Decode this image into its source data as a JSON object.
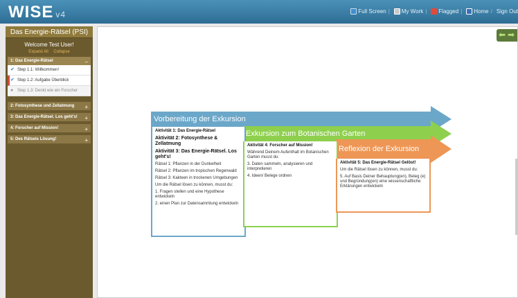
{
  "app": {
    "logo": "WISE",
    "version": "v4"
  },
  "toplinks": {
    "fullscreen": "Full Screen",
    "mywork": "My Work",
    "flagged": "Flagged",
    "home": "Home",
    "signout": "Sign Out",
    "separator": "/"
  },
  "sidebar": {
    "project_title": "Das Energie-Rätsel (PSI)",
    "welcome": "Welcome Test User!",
    "expand_all": "Expand All",
    "collapse": "Collapse",
    "activities": [
      {
        "label": "1: Das Energie-Rätsel",
        "toggle": "−"
      },
      {
        "label": "2: Fotosynthese und Zellatmung",
        "toggle": "+"
      },
      {
        "label": "3: Das Energie-Rätsel. Los geht's!",
        "toggle": "+"
      },
      {
        "label": "4: Forscher auf Mission!",
        "toggle": "+"
      },
      {
        "label": "5: Des Rätsels Lösung!",
        "toggle": "+"
      }
    ],
    "steps": [
      {
        "label": "Step 1.1: Willkommen!"
      },
      {
        "label": "Step 1.2: Aufgabe Überblick"
      },
      {
        "label": "Step 1.3: Denkt wie ein Forscher"
      }
    ]
  },
  "diagram": {
    "banner1": {
      "title": "Vorbereitung der Exkursion",
      "color": "#6ba7c9"
    },
    "banner2": {
      "title": "Exkursion zum Botanischen Garten",
      "color": "#8ed04e"
    },
    "banner3": {
      "title": "Reflexion der Exkursion",
      "color": "#ee9655"
    },
    "box1": {
      "l1": "Aktivität 1: Das Energie-Rätsel",
      "l2": "Aktivität 2: Fotosynthese & Zellatmung",
      "l3": "Aktivität 3:  Das Energie-Rätsel. Los geht's!",
      "l4": "Rätsel 1: Pflanzen in der Dunkelheit",
      "l5": "Rätsel 2: Pflanzen im tropischen Regenwald",
      "l6": "Rätsel 3: Kakteen in trockenen Umgebungen",
      "l7": "Um die Rätsel lösen zu können, musst du:",
      "l8": "1. Fragen stellen und  eine Hypothese entwickeln",
      "l9": "2. einen Plan zur Datensammlung entwickeln"
    },
    "box2": {
      "l1": "Aktivität 4: Forscher auf Mission!",
      "l2": "Während Deinem Aufenthalt im Botanischen Garten musst du:",
      "l3": "3. Daten sammeln, analysieren und interpretieren",
      "l4": "4. Ideen/ Belege ordnen"
    },
    "box3": {
      "l1": "Aktivität 5: Das Energie-Rätsel Gelöst!",
      "l2": "Um die Rätsel lösen zu können, musst du:",
      "l3": "5. Auf Basis Deiner Behauptung(en), Beleg (e) und Begründung(en) eine wissenschaftliche Erklärungen entwickeln"
    }
  }
}
